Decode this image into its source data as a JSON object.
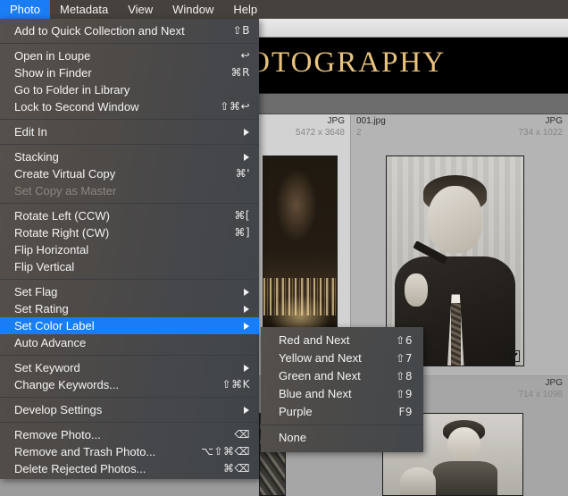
{
  "menubar": {
    "items": [
      {
        "label": "Photo",
        "active": true
      },
      {
        "label": "Metadata",
        "active": false
      },
      {
        "label": "View",
        "active": false
      },
      {
        "label": "Window",
        "active": false
      },
      {
        "label": "Help",
        "active": false
      }
    ]
  },
  "photo_menu": {
    "groups": [
      {
        "items": [
          {
            "label": "Add to Quick Collection and Next",
            "shortcut": "⇧B",
            "submenu": false,
            "disabled": false,
            "selected": false
          }
        ]
      },
      {
        "items": [
          {
            "label": "Open in Loupe",
            "shortcut": "↩",
            "submenu": false,
            "disabled": false,
            "selected": false
          },
          {
            "label": "Show in Finder",
            "shortcut": "⌘R",
            "submenu": false,
            "disabled": false,
            "selected": false
          },
          {
            "label": "Go to Folder in Library",
            "shortcut": "",
            "submenu": false,
            "disabled": false,
            "selected": false
          },
          {
            "label": "Lock to Second Window",
            "shortcut": "⇧⌘↩",
            "submenu": false,
            "disabled": false,
            "selected": false
          }
        ]
      },
      {
        "items": [
          {
            "label": "Edit In",
            "shortcut": "",
            "submenu": true,
            "disabled": false,
            "selected": false
          }
        ]
      },
      {
        "items": [
          {
            "label": "Stacking",
            "shortcut": "",
            "submenu": true,
            "disabled": false,
            "selected": false
          },
          {
            "label": "Create Virtual Copy",
            "shortcut": "⌘'",
            "submenu": false,
            "disabled": false,
            "selected": false
          },
          {
            "label": "Set Copy as Master",
            "shortcut": "",
            "submenu": false,
            "disabled": true,
            "selected": false
          }
        ]
      },
      {
        "items": [
          {
            "label": "Rotate Left (CCW)",
            "shortcut": "⌘[",
            "submenu": false,
            "disabled": false,
            "selected": false
          },
          {
            "label": "Rotate Right (CW)",
            "shortcut": "⌘]",
            "submenu": false,
            "disabled": false,
            "selected": false
          },
          {
            "label": "Flip Horizontal",
            "shortcut": "",
            "submenu": false,
            "disabled": false,
            "selected": false
          },
          {
            "label": "Flip Vertical",
            "shortcut": "",
            "submenu": false,
            "disabled": false,
            "selected": false
          }
        ]
      },
      {
        "items": [
          {
            "label": "Set Flag",
            "shortcut": "",
            "submenu": true,
            "disabled": false,
            "selected": false
          },
          {
            "label": "Set Rating",
            "shortcut": "",
            "submenu": true,
            "disabled": false,
            "selected": false
          },
          {
            "label": "Set Color Label",
            "shortcut": "",
            "submenu": true,
            "disabled": false,
            "selected": true
          },
          {
            "label": "Auto Advance",
            "shortcut": "",
            "submenu": false,
            "disabled": false,
            "selected": false
          }
        ]
      },
      {
        "items": [
          {
            "label": "Set Keyword",
            "shortcut": "",
            "submenu": true,
            "disabled": false,
            "selected": false
          },
          {
            "label": "Change Keywords...",
            "shortcut": "⇧⌘K",
            "submenu": false,
            "disabled": false,
            "selected": false
          }
        ]
      },
      {
        "items": [
          {
            "label": "Develop Settings",
            "shortcut": "",
            "submenu": true,
            "disabled": false,
            "selected": false
          }
        ]
      },
      {
        "items": [
          {
            "label": "Remove Photo...",
            "shortcut": "⌫",
            "submenu": false,
            "disabled": false,
            "selected": false
          },
          {
            "label": "Remove and Trash Photo...",
            "shortcut": "⌥⇧⌘⌫",
            "submenu": false,
            "disabled": false,
            "selected": false
          },
          {
            "label": "Delete Rejected Photos...",
            "shortcut": "⌘⌫",
            "submenu": false,
            "disabled": false,
            "selected": false
          }
        ]
      }
    ]
  },
  "color_label_submenu": {
    "groups": [
      {
        "items": [
          {
            "label": "Red and Next",
            "shortcut": "⇧6"
          },
          {
            "label": "Yellow and Next",
            "shortcut": "⇧7"
          },
          {
            "label": "Green and Next",
            "shortcut": "⇧8"
          },
          {
            "label": "Blue and Next",
            "shortcut": "⇧9"
          },
          {
            "label": "Purple",
            "shortcut": "F9"
          }
        ]
      },
      {
        "items": [
          {
            "label": "None",
            "shortcut": ""
          }
        ]
      }
    ]
  },
  "identity_plate": {
    "text": "PHOTOGRAPHY"
  },
  "grid": {
    "cells": [
      {
        "filename": "",
        "copy": "",
        "format": "JPG",
        "dimensions": "5472 x 3648",
        "selected": true
      },
      {
        "filename": "001.jpg",
        "copy": "2",
        "format": "JPG",
        "dimensions": "734 x 1022",
        "selected": false
      },
      {
        "filename": "",
        "copy": "",
        "format": "JPG",
        "dimensions": "714 x 1098",
        "selected": false
      }
    ],
    "rating_dots": ". . ."
  },
  "colors": {
    "accent": "#1a7df5",
    "menu_text": "#f4f4f4",
    "disabled_text": "#8b8781",
    "identity_gold": "#e8c37e",
    "menubar_band": "#46413c"
  }
}
